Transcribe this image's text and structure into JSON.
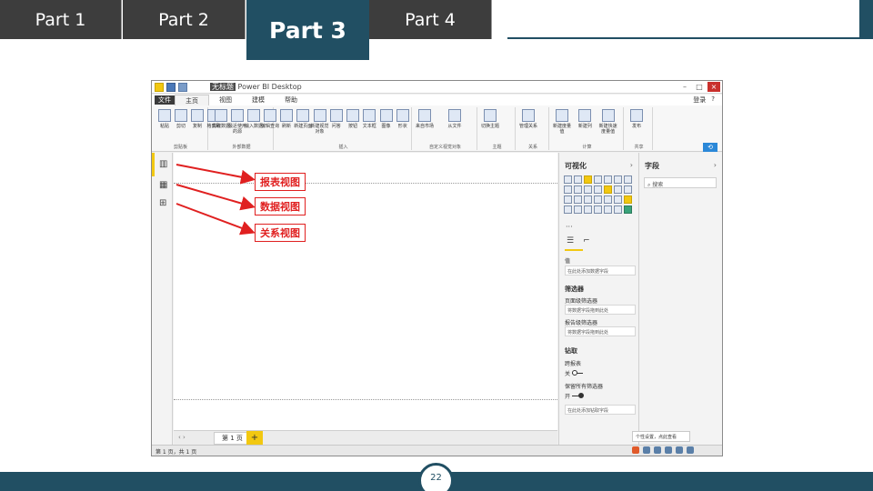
{
  "slide": {
    "tabs": [
      "Part 1",
      "Part 2",
      "Part 3",
      "Part 4"
    ],
    "page_number": "22",
    "accent_color": "#214f63",
    "tab_color": "#3d3d3d"
  },
  "window": {
    "title_prefix": "无标题",
    "title_app": "Power BI Desktop",
    "file_tab": "文件",
    "ribbon_tabs": [
      "主页",
      "视图",
      "建模",
      "帮助"
    ],
    "right_items": [
      "登录",
      "?"
    ],
    "ribbon_groups": [
      {
        "label": "剪贴板",
        "buttons": [
          "粘贴",
          "剪切",
          "复制",
          "格式刷"
        ]
      },
      {
        "label": "外部数据",
        "buttons": [
          "获取数据",
          "最近使用的源",
          "输入数据",
          "编辑查询"
        ]
      },
      {
        "label": "插入",
        "buttons": [
          "刷新",
          "新建页面",
          "新建视觉对象",
          "问答",
          "按钮",
          "文本框",
          "图像",
          "形状"
        ]
      },
      {
        "label": "自定义视觉对象",
        "buttons": [
          "来自市场",
          "从文件"
        ]
      },
      {
        "label": "主题",
        "buttons": [
          "切换主题"
        ]
      },
      {
        "label": "关系",
        "buttons": [
          "管理关系"
        ]
      },
      {
        "label": "计算",
        "buttons": [
          "新建度量值",
          "新建列",
          "新建快速度量值"
        ]
      },
      {
        "label": "共享",
        "buttons": [
          "发布"
        ]
      }
    ],
    "left_rail": [
      "report-icon",
      "data-icon",
      "relationship-icon"
    ],
    "annotations": [
      "报表视图",
      "数据视图",
      "关系视图"
    ],
    "page_tab": "第 1 页",
    "page_add": "+",
    "status_text": "第 1 页，共 1 页",
    "viz_pane": {
      "title": "可视化",
      "values_label": "值",
      "values_well": "在此处添加数据字段",
      "filters_title": "筛选器",
      "page_filter_label": "页面级筛选器",
      "page_filter_well": "将数据字段拖到此处",
      "report_filter_label": "报告级筛选器",
      "report_filter_well": "将数据字段拖到此处",
      "drill_title": "钻取",
      "cross_report_label": "跨报表",
      "cross_report_state": "关",
      "keep_filters_label": "保留所有筛选器",
      "keep_filters_state": "开",
      "drill_well": "在此处添加钻取字段"
    },
    "fields_pane": {
      "title": "字段",
      "search_placeholder": "搜索"
    },
    "tooltip": "个性设置，点此查看",
    "pane_chevron": "›",
    "page_nav": "‹ ›",
    "viz_more": "···"
  }
}
